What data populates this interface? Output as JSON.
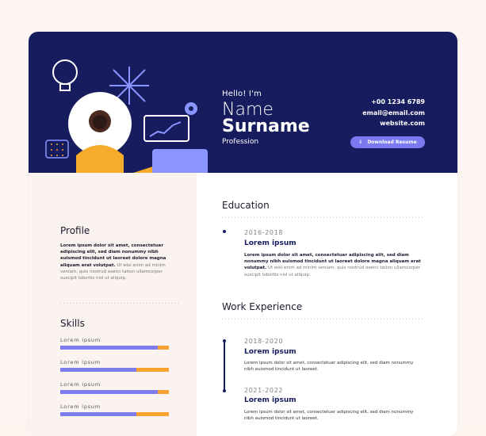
{
  "header": {
    "hello": "Hello! I'm",
    "name": "Name",
    "surname": "Surname",
    "profession": "Profession",
    "contact": {
      "phone": "+00 1234 6789",
      "email": "email@email.com",
      "website": "website.com"
    },
    "download_label": "Download Resume"
  },
  "profile": {
    "title": "Profile",
    "text_bold": "Lorem ipsum dolor sit amet, consectetuer adipiscing elit, sed diam nonummy nibh euismod tincidunt ut laoreet dolore magna aliquam erat volutpat.",
    "text_light": "Ut wisi enim ad minim veniam, quis nostrud exerci tation ullamcorper suscipit lobortis nisl ut aliquip."
  },
  "skills": {
    "title": "Skills",
    "items": [
      {
        "label": "Lorem ipsum",
        "level": 0.9
      },
      {
        "label": "Lorem ipsum",
        "level": 0.7
      },
      {
        "label": "Lorem ipsum",
        "level": 0.9
      },
      {
        "label": "Lorem ipsum",
        "level": 0.7
      }
    ]
  },
  "education": {
    "title": "Education",
    "items": [
      {
        "period": "2016-2018",
        "title": "Lorem ipsum",
        "text_bold": "Lorem ipsum dolor sit amet, consectetuer adipiscing elit, sed diam nonummy nibh euismod tincidunt ut laoreet dolore magna aliquam erat volutpat.",
        "text_light": "Ut wisi enim ad minim veniam, quis nostrud exerci tation ullamcorper suscipit lobortis nisl ut aliquip."
      }
    ]
  },
  "work": {
    "title": "Work Experience",
    "items": [
      {
        "period": "2018-2020",
        "title": "Lorem ipsum",
        "text": "Lorem ipsum dolor sit amet, consectetuer adipiscing elit, sed diam nonummy nibh euismod tincidunt ut laoreet."
      },
      {
        "period": "2021-2022",
        "title": "Lorem ipsum",
        "text": "Lorem ipsum dolor sit amet, consectetuer adipiscing elit, sed diam nonummy nibh euismod tincidunt ut laoreet."
      }
    ]
  },
  "colors": {
    "navy": "#161c5e",
    "accent": "#7b79f0",
    "orange": "#f9a12f",
    "left_bg": "#fbf3ef"
  }
}
